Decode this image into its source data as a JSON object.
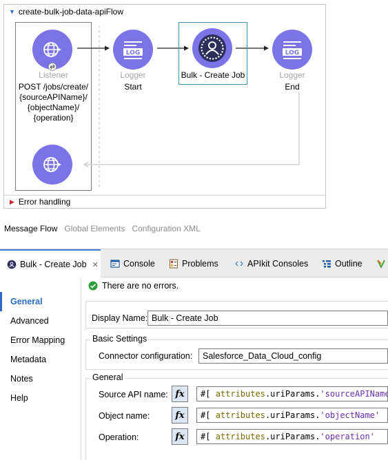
{
  "flow": {
    "name": "create-bulk-job-data-apiFlow",
    "listener": {
      "label": "Listener",
      "path_line1": "POST /jobs/create/",
      "path_line2": "{sourceAPIName}/",
      "path_line3": "{objectName}/",
      "path_line4": "{operation}"
    },
    "logger_start": {
      "label": "Logger",
      "sublabel": "Start"
    },
    "create_job": {
      "label": "Bulk - Create Job"
    },
    "logger_end": {
      "label": "Logger",
      "sublabel": "End"
    },
    "log_icon_text": "LOG",
    "error_handling": "Error handling"
  },
  "editor_tabs": [
    {
      "label": "Message Flow",
      "active": true
    },
    {
      "label": "Global Elements",
      "active": false
    },
    {
      "label": "Configuration XML",
      "active": false
    }
  ],
  "panel_tabs": {
    "active": {
      "label": "Bulk - Create Job",
      "close": "✕"
    },
    "console": "Console",
    "problems": "Problems",
    "apikit": "APIkit Consoles",
    "outline": "Outline"
  },
  "side_nav": [
    "General",
    "Advanced",
    "Error Mapping",
    "Metadata",
    "Notes",
    "Help"
  ],
  "status": {
    "text": "There are no errors."
  },
  "form": {
    "display_name_label": "Display Name:",
    "display_name_value": "Bulk - Create Job",
    "basic_settings_title": "Basic Settings",
    "connector_config_label": "Connector configuration:",
    "connector_config_value": "Salesforce_Data_Cloud_config",
    "general_title": "General",
    "fx_label": "fx",
    "fields": [
      {
        "label": "Source API name:",
        "prefix": "#[",
        "obj": "attributes",
        "dot1": ".",
        "prop": "uriParams",
        "dot2": ".",
        "str": "'sourceAPIName'"
      },
      {
        "label": "Object name:",
        "prefix": "#[",
        "obj": "attributes",
        "dot1": ".",
        "prop": "uriParams",
        "dot2": ".",
        "str": "'objectName'"
      },
      {
        "label": "Operation:",
        "prefix": "#[",
        "obj": "attributes",
        "dot1": ".",
        "prop": "uriParams",
        "dot2": ".",
        "str": "'operation'"
      }
    ]
  },
  "colors": {
    "node_purple": "#7b73e6",
    "accent_blue": "#3d7fd6",
    "error_red": "#c8202e",
    "ok_green": "#2e9d3a"
  }
}
